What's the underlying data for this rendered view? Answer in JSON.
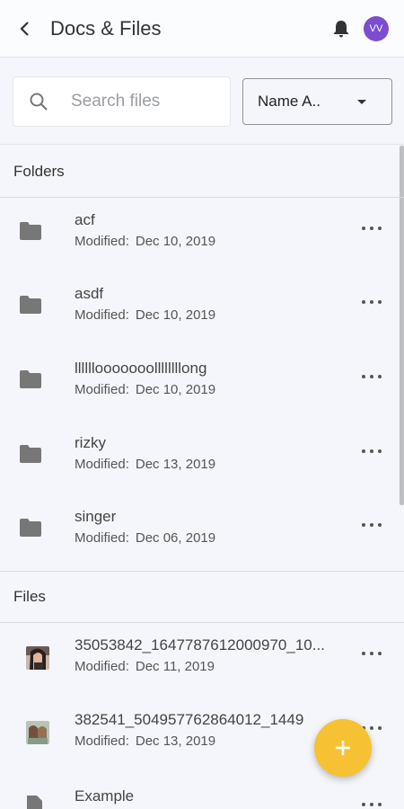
{
  "header": {
    "title": "Docs & Files",
    "avatar_initials": "VV",
    "avatar_color": "#7c4dcc"
  },
  "toolbar": {
    "search_placeholder": "Search files",
    "sort_label": "Name A.."
  },
  "sections": {
    "folders_title": "Folders",
    "files_title": "Files"
  },
  "modified_label": "Modified:",
  "folders": [
    {
      "name": "acf",
      "date": "Dec 10, 2019",
      "icon": "folder-icon"
    },
    {
      "name": "asdf",
      "date": "Dec 10, 2019",
      "icon": "folder-icon"
    },
    {
      "name": "llllllooooooollllllllong",
      "date": "Dec 10, 2019",
      "icon": "folder-icon"
    },
    {
      "name": "rizky",
      "date": "Dec 13, 2019",
      "icon": "folder-icon"
    },
    {
      "name": "singer",
      "date": "Dec 06, 2019",
      "icon": "folder-icon"
    }
  ],
  "files": [
    {
      "name": "35053842_1647787612000970_10...",
      "date": "Dec 11, 2019",
      "icon": "image-thumbnail"
    },
    {
      "name": "382541_504957762864012_1449",
      "date": "Dec 13, 2019",
      "icon": "image-thumbnail"
    },
    {
      "name": "Example",
      "date": "",
      "icon": "document-icon"
    }
  ],
  "colors": {
    "accent_fab": "#f6c234",
    "background": "#f4f6fb"
  }
}
